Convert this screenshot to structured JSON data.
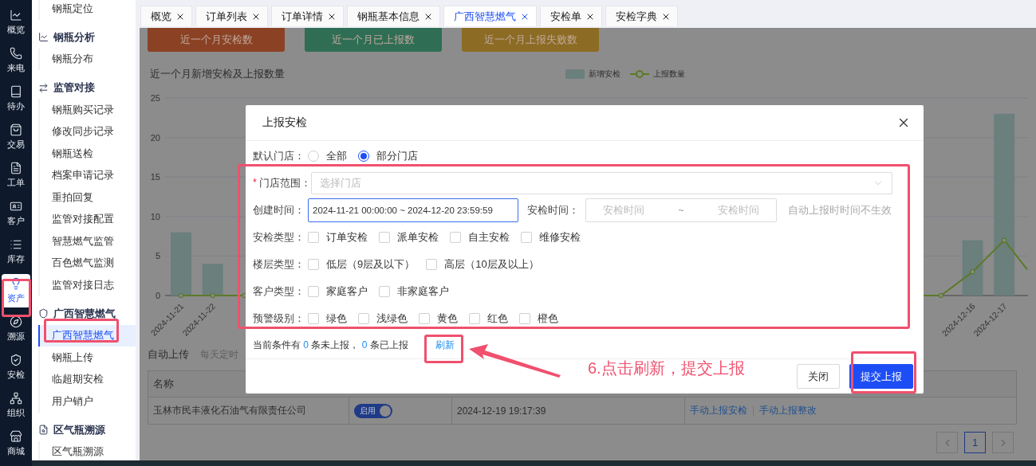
{
  "rail": [
    {
      "label": "概览",
      "selected": false
    },
    {
      "label": "来电",
      "selected": false
    },
    {
      "label": "待办",
      "selected": false
    },
    {
      "label": "交易",
      "selected": false
    },
    {
      "label": "工单",
      "selected": false
    },
    {
      "label": "客户",
      "selected": false
    },
    {
      "label": "库存",
      "selected": false
    },
    {
      "label": "资产",
      "selected": true
    },
    {
      "label": "溯源",
      "selected": false
    },
    {
      "label": "安检",
      "selected": false
    },
    {
      "label": "组织",
      "selected": false
    },
    {
      "label": "商城",
      "selected": false
    }
  ],
  "menu": [
    {
      "kind": "item",
      "label": "钢瓶定位",
      "selected": false
    },
    {
      "kind": "group",
      "label": "钢瓶分析"
    },
    {
      "kind": "item",
      "label": "钢瓶分布",
      "selected": false
    },
    {
      "kind": "group",
      "label": "监管对接"
    },
    {
      "kind": "item",
      "label": "钢瓶购买记录",
      "selected": false
    },
    {
      "kind": "item",
      "label": "修改同步记录",
      "selected": false
    },
    {
      "kind": "item",
      "label": "钢瓶送检",
      "selected": false
    },
    {
      "kind": "item",
      "label": "档案申请记录",
      "selected": false
    },
    {
      "kind": "item",
      "label": "重拍回复",
      "selected": false
    },
    {
      "kind": "item",
      "label": "监管对接配置",
      "selected": false
    },
    {
      "kind": "item",
      "label": "智慧燃气监管",
      "selected": false
    },
    {
      "kind": "item",
      "label": "百色燃气监测",
      "selected": false
    },
    {
      "kind": "item",
      "label": "监管对接日志",
      "selected": false
    },
    {
      "kind": "group",
      "label": "广西智慧燃气"
    },
    {
      "kind": "item",
      "label": "广西智慧燃气",
      "selected": true
    },
    {
      "kind": "item",
      "label": "钢瓶上传",
      "selected": false
    },
    {
      "kind": "item",
      "label": "临超期安检",
      "selected": false
    },
    {
      "kind": "item",
      "label": "用户销户",
      "selected": false
    },
    {
      "kind": "group",
      "label": "区气瓶溯源"
    },
    {
      "kind": "item",
      "label": "区气瓶溯源",
      "selected": false
    }
  ],
  "tabs": [
    {
      "label": "概览",
      "selected": false
    },
    {
      "label": "订单列表",
      "selected": false
    },
    {
      "label": "订单详情",
      "selected": false
    },
    {
      "label": "钢瓶基本信息",
      "selected": false
    },
    {
      "label": "广西智慧燃气",
      "selected": true
    },
    {
      "label": "安检单",
      "selected": false
    },
    {
      "label": "安检字典",
      "selected": false
    }
  ],
  "cards": [
    {
      "label": "近一个月安检数",
      "color": "#8b4224"
    },
    {
      "label": "近一个月已上报数",
      "color": "#2f6e55"
    },
    {
      "label": "近一个月上报失败数",
      "color": "#8c6c24"
    }
  ],
  "chart": {
    "title": "近一个月新增安检及上报数量",
    "bars": {
      "chart_data": {
        "type": "bar",
        "grid": true,
        "categories": [
          "2024-11-21",
          "2024-11-22",
          null,
          null,
          null,
          null,
          null,
          null,
          null,
          null,
          null,
          null,
          null,
          null,
          null,
          null,
          null,
          null,
          null,
          null,
          null,
          null,
          null,
          null,
          null,
          "2024-12-16",
          "2024-12-17",
          null
        ],
        "ylim": [
          0,
          25
        ],
        "yticks": [
          0,
          5,
          10,
          15,
          20,
          25
        ],
        "series": [
          {
            "name": "新增安检",
            "color": "#6b7f7c",
            "values": [
              8,
              4,
              null,
              null,
              null,
              null,
              null,
              null,
              null,
              null,
              null,
              null,
              null,
              null,
              null,
              null,
              null,
              null,
              null,
              null,
              null,
              null,
              null,
              null,
              null,
              7,
              23,
              null
            ]
          }
        ]
      }
    },
    "line": {
      "name": "上报数量"
    }
  },
  "auto_upload": {
    "title": "自动上传",
    "hint": "每天定时"
  },
  "table": {
    "columns": [
      "名称"
    ],
    "rows": [
      {
        "name": "玉林市民丰液化石油气有限责任公司",
        "switch": {
          "label": "启用",
          "on": true
        },
        "time": "2024-12-19 19:17:39",
        "actions": [
          "手动上报安检",
          "手动上报整改"
        ]
      }
    ]
  },
  "pagination": {
    "pages": [
      {
        "label": "1",
        "selected": true
      }
    ]
  },
  "modal": {
    "title": "上报安检",
    "default_store": {
      "label": "默认门店：",
      "options": [
        {
          "label": "全部",
          "selected": false
        },
        {
          "label": "部分门店",
          "selected": true
        }
      ]
    },
    "store_range": {
      "required_mark": "*",
      "label": "门店范围：",
      "placeholder": "选择门店"
    },
    "created": {
      "label": "创建时间：",
      "value": "2024-11-21 00:00:00 ~ 2024-12-20 23:59:59",
      "focused": true
    },
    "inspect_time": {
      "label": "安检时间：",
      "start_placeholder": "安检时间",
      "separator": "~",
      "end_placeholder": "安检时间",
      "hint": "自动上报时时间不生效"
    },
    "checkbox_groups": [
      {
        "label": "安检类型：",
        "options": [
          {
            "label": "订单安检",
            "checked": false
          },
          {
            "label": "派单安检",
            "checked": false
          },
          {
            "label": "自主安检",
            "checked": false
          },
          {
            "label": "维修安检",
            "checked": false
          }
        ]
      },
      {
        "label": "楼层类型：",
        "options": [
          {
            "label": "低层（9层及以下）",
            "checked": false
          },
          {
            "label": "高层（10层及以上）",
            "checked": false
          }
        ]
      },
      {
        "label": "客户类型：",
        "options": [
          {
            "label": "家庭客户",
            "checked": false
          },
          {
            "label": "非家庭客户",
            "checked": false
          }
        ]
      },
      {
        "label": "预警级别：",
        "options": [
          {
            "label": "绿色",
            "checked": false
          },
          {
            "label": "浅绿色",
            "checked": false
          },
          {
            "label": "黄色",
            "checked": false
          },
          {
            "label": "红色",
            "checked": false
          },
          {
            "label": "橙色",
            "checked": false
          }
        ]
      }
    ],
    "summary": {
      "text_1": "当前条件有",
      "pending": "0",
      "text_2": "条未上报，",
      "reported": "0",
      "text_3": "条已上报"
    },
    "refresh": "刷新",
    "buttons": [
      {
        "label": "关闭",
        "kind": "default"
      },
      {
        "label": "提交上报",
        "kind": "primary"
      }
    ]
  },
  "annotation": {
    "text": "6.点击刷新，提交上报"
  }
}
